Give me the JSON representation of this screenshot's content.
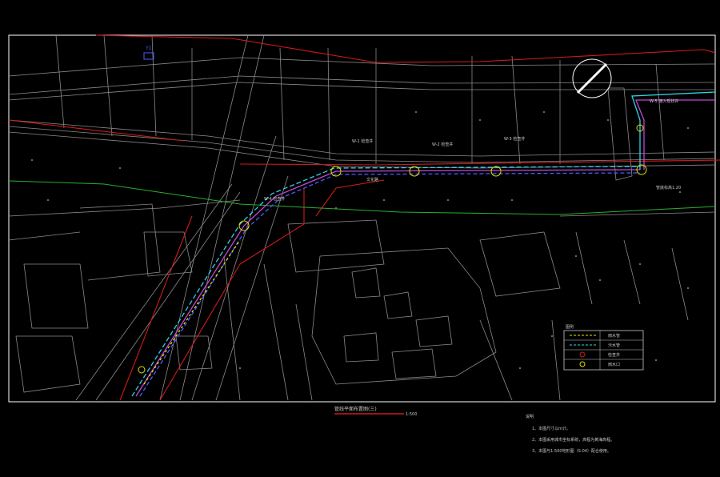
{
  "drawing": {
    "title": "管线平面布置图(三)",
    "scale": "1:500",
    "colors": {
      "background": "#000000",
      "frame": "#ffffff",
      "cad_gray": "#8a8a8a",
      "red_line": "#d11a1a",
      "green_line": "#27b02d",
      "cyan_line": "#2fd3e6",
      "magenta_line": "#c447d6",
      "blue_line": "#4a5bff",
      "yellow": "#e5e000",
      "annotation": "#c8c8c8"
    }
  },
  "notes": {
    "heading": "说明",
    "items": [
      "1、本图尺寸以m计。",
      "2、本图采用城市坐标系统，高程为黄海高程。",
      "3、本图与1:500地形图（S-04）配合使用。"
    ]
  },
  "legend": {
    "heading": "图例",
    "rows": [
      {
        "symbol": "yellow-dashed-line",
        "desc": "雨水管"
      },
      {
        "symbol": "cyan-dashed-line",
        "desc": "污水管"
      },
      {
        "symbol": "manhole-circle",
        "desc": "检查井"
      },
      {
        "symbol": "inlet-circle",
        "desc": "雨水口"
      }
    ]
  },
  "annotations": {
    "top_left": "Y1",
    "well_1": "W-1 检查井",
    "well_2": "W-2 检查井",
    "well_3": "W-3 检查井",
    "well_4": "W-4 检查井",
    "road_label": "文化路",
    "right_box": "W-5 接入现状井",
    "right_lower": "管底标高1.20"
  }
}
